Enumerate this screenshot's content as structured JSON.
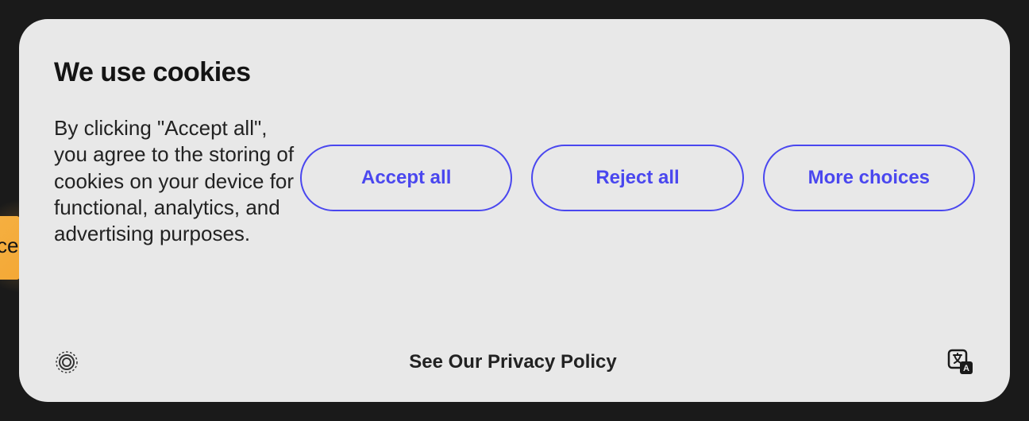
{
  "background": {
    "peek_text": "ce"
  },
  "cookie_modal": {
    "title": "We use cookies",
    "description": "By clicking \"Accept all\", you agree to the storing of cookies on your device for functional, analytics, and advertising purposes.",
    "buttons": {
      "accept": "Accept all",
      "reject": "Reject all",
      "choices": "More choices"
    },
    "footer_link": "See Our Privacy Policy"
  }
}
